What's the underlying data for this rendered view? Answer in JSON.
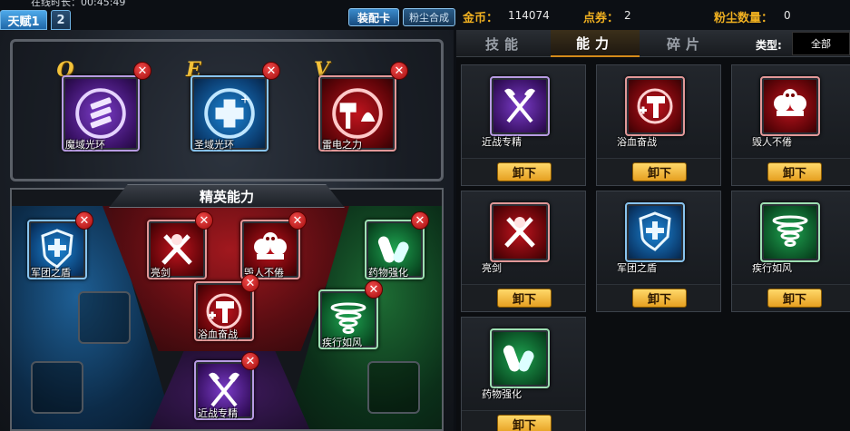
{
  "top_bar": {
    "online_time": "在线时长：00:45:49",
    "tab_active": "天赋1",
    "tab_other": "2",
    "equip_card_button": "装配卡",
    "dust_synthesis_button": "粉尘合成",
    "gold_label": "金币：",
    "gold_value": "114074",
    "points_label": "点券：",
    "points_value": "2",
    "dust_label": "粉尘数量：",
    "dust_value": "0"
  },
  "left": {
    "hotkeys": [
      "Q",
      "E",
      "V"
    ],
    "skills": [
      {
        "key": "Q",
        "name": "魔域光环",
        "icon": "book-stack-icon",
        "color": "#7b3cc9"
      },
      {
        "key": "E",
        "name": "圣域光环",
        "icon": "plus-cross-icon",
        "color": "#1c86d6"
      },
      {
        "key": "V",
        "name": "雷电之力",
        "icon": "hammer-bell-icon",
        "color": "#c0141e"
      }
    ],
    "elite_title": "精英能力",
    "elite_slots": [
      {
        "name": "军团之盾",
        "icon": "shield-cross-icon"
      },
      {
        "name": "亮剑",
        "icon": "crossed-swords-icon"
      },
      {
        "name": "毁人不倦",
        "icon": "skulls-icon"
      },
      {
        "name": "药物强化",
        "icon": "capsule-icon"
      },
      {
        "name": "浴血奋战",
        "icon": "hammer-plus-icon"
      },
      {
        "name": "疾行如风",
        "icon": "tornado-icon"
      },
      {
        "name": "近战专精",
        "icon": "crossed-axes-icon"
      }
    ]
  },
  "right": {
    "tabs": [
      "技能",
      "能力",
      "碎片"
    ],
    "active_tab": "能力",
    "type_label": "类型:",
    "type_value": "全部",
    "unload_label": "卸下",
    "cards": [
      {
        "name": "近战专精",
        "icon": "crossed-axes-icon"
      },
      {
        "name": "浴血奋战",
        "icon": "hammer-plus-icon"
      },
      {
        "name": "毁人不倦",
        "icon": "skulls-icon"
      },
      {
        "name": "亮剑",
        "icon": "crossed-swords-icon"
      },
      {
        "name": "军团之盾",
        "icon": "shield-cross-icon"
      },
      {
        "name": "疾行如风",
        "icon": "tornado-icon"
      },
      {
        "name": "药物强化",
        "icon": "capsule-icon"
      }
    ]
  },
  "remove_symbol": "✕"
}
